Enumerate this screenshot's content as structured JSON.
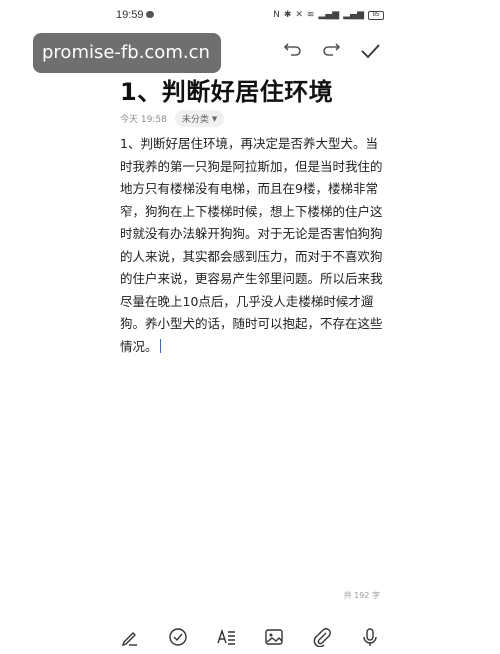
{
  "status": {
    "time": "19:59",
    "battery": "85"
  },
  "watermark": "promise-fb.com.cn",
  "note": {
    "title": "1、判断好居住环境",
    "date": "今天 19:58",
    "category": "未分类",
    "body": "1、判断好居住环境，再决定是否养大型犬。当时我养的第一只狗是阿拉斯加，但是当时我住的地方只有楼梯没有电梯，而且在9楼，楼梯非常窄，狗狗在上下楼梯时候，想上下楼梯的住户这时就没有办法躲开狗狗。对于无论是否害怕狗狗的人来说，其实都会感到压力，而对于不喜欢狗的住户来说，更容易产生邻里问题。所以后来我尽量在晚上10点后，几乎没人走楼梯时候才遛狗。养小型犬的话，随时可以抱起，不存在这些情况。",
    "char_count": "共 192 字"
  },
  "icons": {
    "undo": "undo-icon",
    "redo": "redo-icon",
    "done": "check-icon",
    "toolbar": [
      "pen-icon",
      "checklist-icon",
      "text-format-icon",
      "image-icon",
      "attachment-icon",
      "microphone-icon"
    ]
  }
}
